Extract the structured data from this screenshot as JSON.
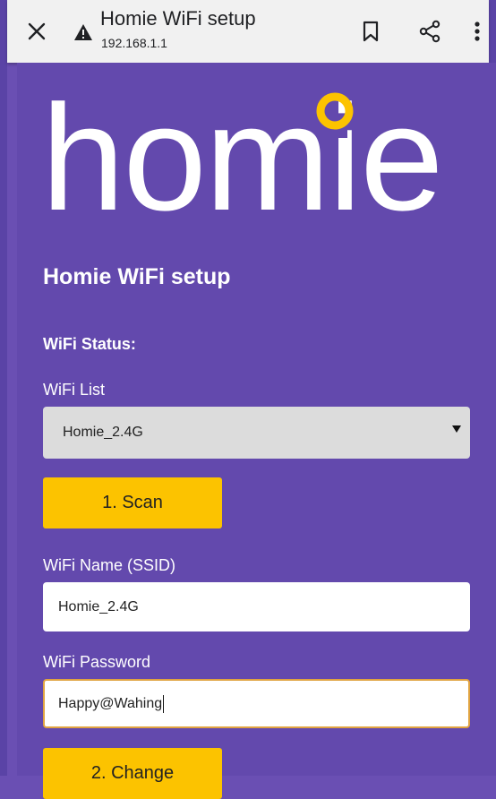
{
  "browser": {
    "page_title": "Homie WiFi setup",
    "url": "192.168.1.1",
    "icons": [
      "close-icon",
      "warning-icon",
      "bookmark-icon",
      "share-icon",
      "more-icon"
    ]
  },
  "page": {
    "logo_text": "homie",
    "heading": "Homie WiFi setup",
    "status_label": "WiFi Status:",
    "wifi_list_label": "WiFi List",
    "wifi_list_selected": "Homie_2.4G",
    "scan_button": "1. Scan",
    "ssid_label": "WiFi Name (SSID)",
    "ssid_value": "Homie_2.4G",
    "password_label": "WiFi Password",
    "password_value": "Happy@Wahing",
    "change_button": "2. Change"
  },
  "colors": {
    "background": "#6349ad",
    "accent": "#fcc300",
    "select_bg": "#dcdcdc"
  }
}
